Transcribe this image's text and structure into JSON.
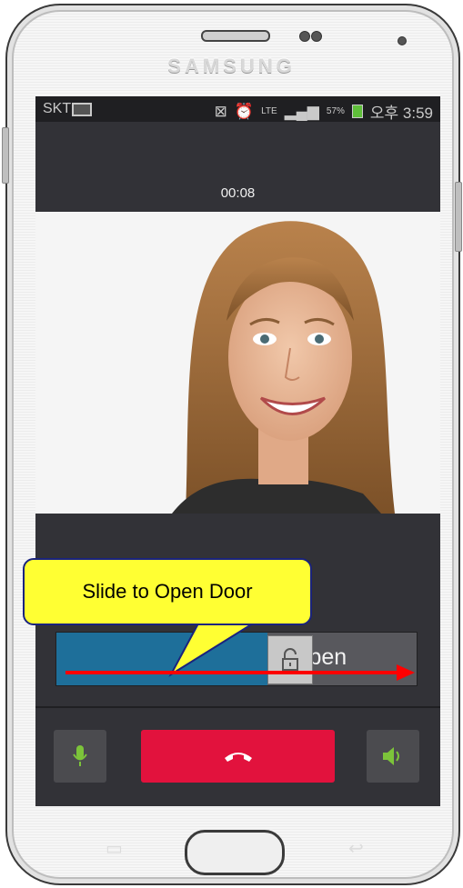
{
  "device": {
    "brand": "SAMSUNG"
  },
  "status_bar": {
    "carrier": "SKT",
    "network": "LTE",
    "battery": "57%",
    "time": "오후 3:59"
  },
  "call": {
    "timer": "00:08"
  },
  "door_slider": {
    "label": "Open"
  },
  "callout": {
    "text": "Slide to Open Door"
  },
  "icons": {
    "mic": "microphone-icon",
    "end_call": "phone-hangup-icon",
    "speaker": "speaker-icon",
    "unlock": "unlock-icon",
    "arrow": "right-arrow-icon"
  },
  "colors": {
    "slider_fill": "#1e6f9a",
    "end_call": "#e2123d",
    "callout_bg": "#ffff33",
    "arrow": "#ff0000",
    "active_icon": "#7cc43a"
  }
}
